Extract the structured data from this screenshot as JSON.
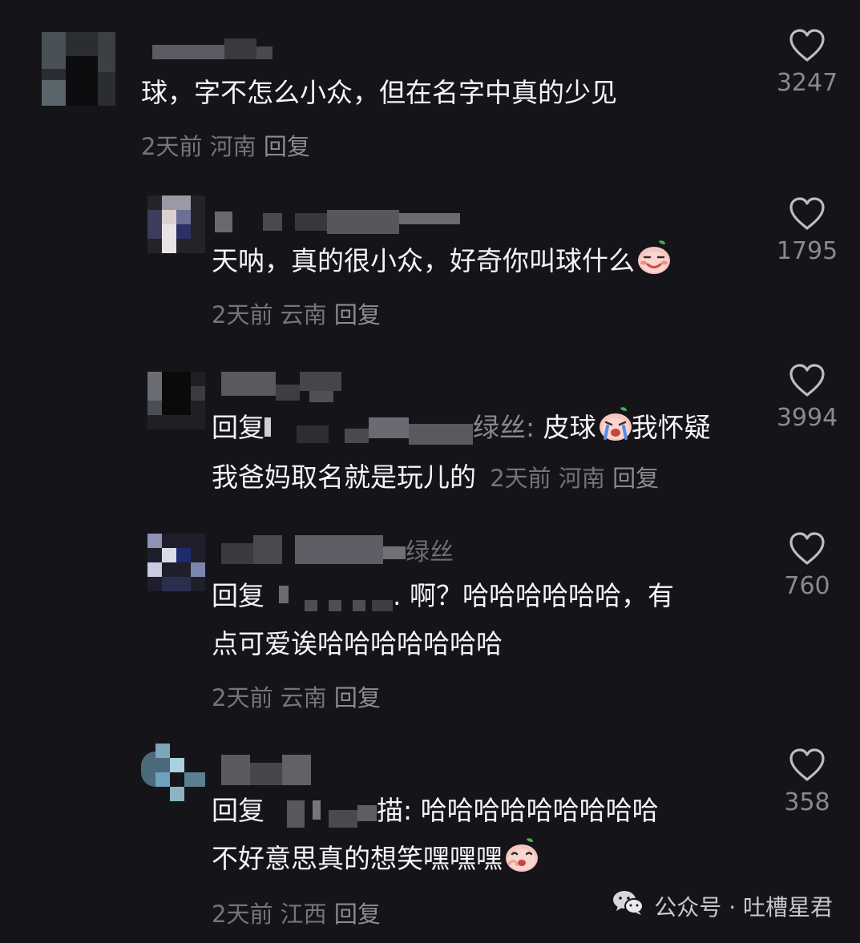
{
  "comments": [
    {
      "text": "球，字不怎么小众，但在名字中真的少见",
      "time": "2天前",
      "region": "河南",
      "reply_label": "回复",
      "likes": "3247"
    },
    {
      "name_tail": "",
      "text": "天呐，真的很小众，好奇你叫球什么",
      "time": "2天前",
      "region": "云南",
      "reply_label": "回复",
      "likes": "1795"
    },
    {
      "reply_prefix": "回复",
      "reply_suffix": "绿丝:",
      "text_line1": "皮球",
      "text_line1_after": "我怀疑",
      "text_line2": "我爸妈取名就是玩儿的",
      "time": "2天前",
      "region": "河南",
      "reply_label": "回复",
      "likes": "3994"
    },
    {
      "name_tail": "绿丝",
      "reply_prefix": "回复",
      "text_line1": ". 啊？哈哈哈哈哈哈，有",
      "text_line2": "点可爱诶哈哈哈哈哈哈哈",
      "time": "2天前",
      "region": "云南",
      "reply_label": "回复",
      "likes": "760"
    },
    {
      "reply_prefix": "回复",
      "text_line1": "描: 哈哈哈哈哈哈哈哈哈",
      "text_line2": "不好意思真的想笑嘿嘿嘿",
      "time": "2天前",
      "region": "江西",
      "reply_label": "回复",
      "likes": "358"
    }
  ],
  "watermark": {
    "icon": "wechat-icon",
    "text": "公众号 · 吐槽星君"
  },
  "icons": {
    "like": "heart-outline-icon",
    "emoji": "peach-face-emoji"
  },
  "colors": {
    "background": "#151419",
    "text": "#f4f4f6",
    "meta": "#75747c",
    "count": "#8a8990"
  }
}
